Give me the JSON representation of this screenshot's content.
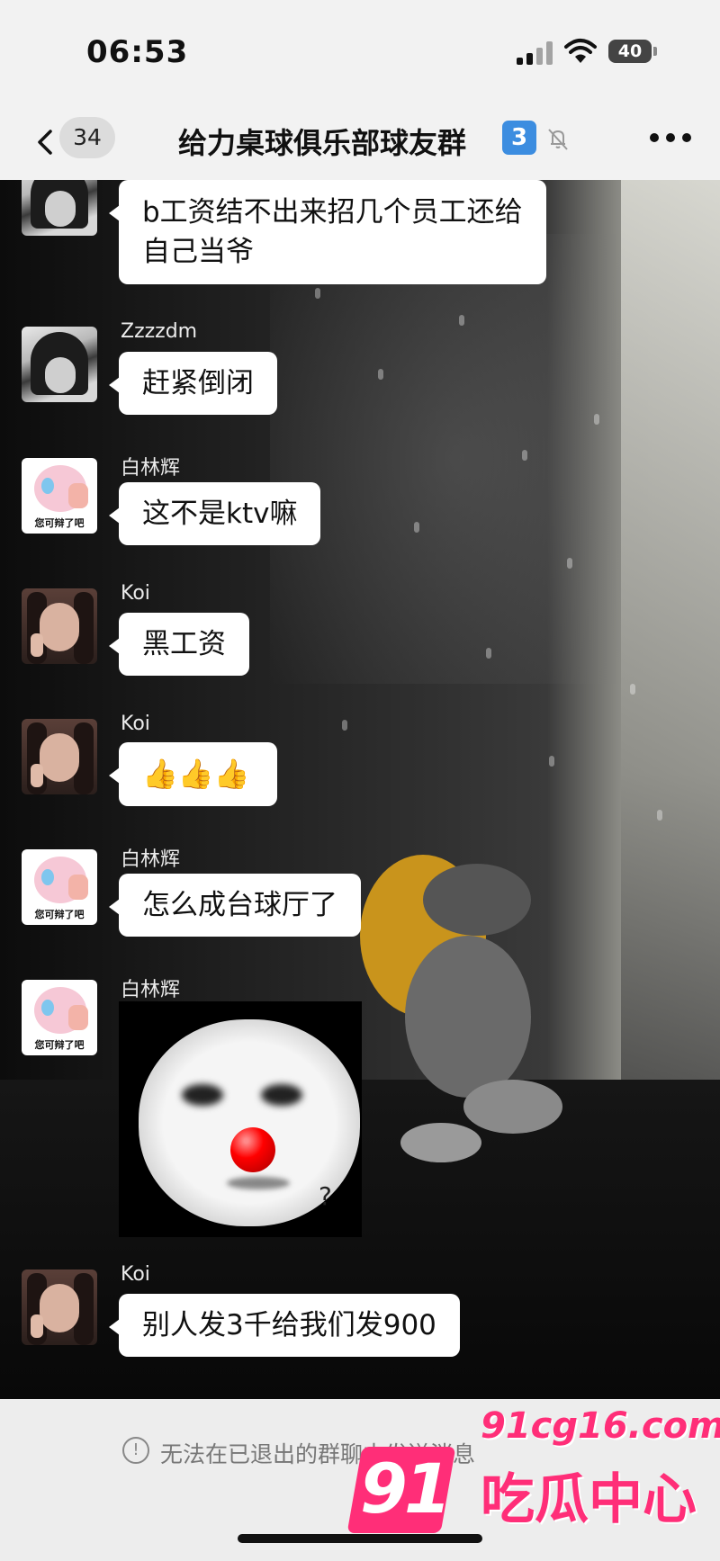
{
  "status_bar": {
    "time": "06:53",
    "battery": "40"
  },
  "header": {
    "back_count": "34",
    "title": "给力桌球俱乐部球友群",
    "title_badge": "3"
  },
  "messages": [
    {
      "sender": "",
      "text_line1": "b工资结不出来招几个员工还给",
      "text_line2": "自己当爷"
    },
    {
      "sender": "Zzzzdm",
      "text": "赶紧倒闭"
    },
    {
      "sender": "白林辉",
      "text": "这不是ktv嘛"
    },
    {
      "sender": "Koi",
      "text": "黑工资"
    },
    {
      "sender": "Koi",
      "text": "👍👍👍"
    },
    {
      "sender": "白林辉",
      "text": "怎么成台球厅了"
    },
    {
      "sender": "白林辉",
      "sticker": "clown-face-sticker"
    },
    {
      "sender": "Koi",
      "text": "别人发3千给我们发900"
    }
  ],
  "avatars": {
    "pink_caption": "您可辩了吧"
  },
  "footer": {
    "notice": "无法在已退出的群聊中发送消息"
  },
  "watermark": {
    "url": "91cg16.com",
    "brand_num": "91",
    "brand_cn": "吃瓜中心"
  },
  "colors": {
    "accent_pink": "#ff2e78",
    "badge_blue": "#3c8de0",
    "bubble_white": "#ffffff"
  }
}
